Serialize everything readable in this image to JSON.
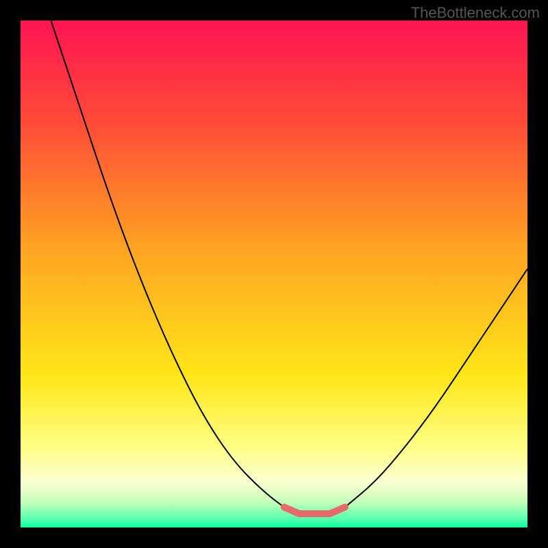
{
  "watermark": "TheBottleneck.com",
  "chart_data": {
    "type": "line",
    "title": "",
    "xlabel": "",
    "ylabel": "",
    "xlim": [
      0,
      100
    ],
    "ylim": [
      0,
      100
    ],
    "background_gradient": {
      "stops": [
        {
          "pos": 0.0,
          "color": "#ff1452"
        },
        {
          "pos": 0.2,
          "color": "#ff4b38"
        },
        {
          "pos": 0.45,
          "color": "#ffa322"
        },
        {
          "pos": 0.7,
          "color": "#ffe618"
        },
        {
          "pos": 0.84,
          "color": "#ffff82"
        },
        {
          "pos": 0.91,
          "color": "#faffd0"
        },
        {
          "pos": 0.95,
          "color": "#c5ffb9"
        },
        {
          "pos": 0.985,
          "color": "#4fffac"
        },
        {
          "pos": 1.0,
          "color": "#00ff9a"
        }
      ]
    },
    "series": [
      {
        "name": "curve",
        "color": "#000000",
        "width": 2,
        "points_left": [
          {
            "x": 6,
            "y": 0
          },
          {
            "x": 12,
            "y": 18
          },
          {
            "x": 18,
            "y": 36
          },
          {
            "x": 24,
            "y": 52
          },
          {
            "x": 30,
            "y": 66
          },
          {
            "x": 36,
            "y": 78
          },
          {
            "x": 42,
            "y": 87
          },
          {
            "x": 48,
            "y": 93
          },
          {
            "x": 52,
            "y": 96
          }
        ],
        "points_right": [
          {
            "x": 64,
            "y": 96
          },
          {
            "x": 70,
            "y": 91
          },
          {
            "x": 76,
            "y": 84
          },
          {
            "x": 82,
            "y": 76
          },
          {
            "x": 88,
            "y": 67
          },
          {
            "x": 94,
            "y": 58
          },
          {
            "x": 100,
            "y": 49
          }
        ]
      },
      {
        "name": "anomaly-marker",
        "color": "#e76a6a",
        "width": 10,
        "points": [
          {
            "x": 52,
            "y": 96
          },
          {
            "x": 55,
            "y": 97.3
          },
          {
            "x": 58,
            "y": 97.3
          },
          {
            "x": 61,
            "y": 97.3
          },
          {
            "x": 64,
            "y": 96
          }
        ]
      }
    ]
  }
}
